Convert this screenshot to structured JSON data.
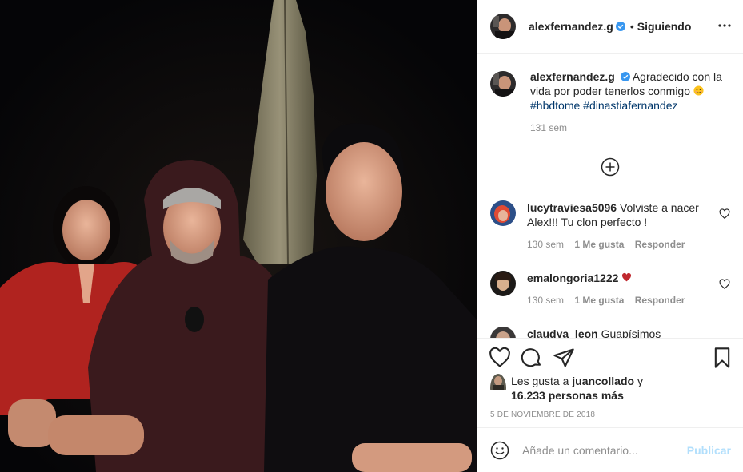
{
  "post": {
    "username": "alexfernandez.g",
    "verified": true,
    "separator": "•",
    "follow_state": "Siguiendo",
    "more_icon": "more-horizontal-icon"
  },
  "caption": {
    "username": "alexfernandez.g",
    "text": "Agradecido con la vida por poder tenerlos conmigo",
    "emoji": "smiling-face-emoji",
    "hashtags": [
      "#hbdtome",
      "#dinastiafernandez"
    ],
    "time": "131 sem"
  },
  "load_more_icon": "plus-circle-icon",
  "comments": [
    {
      "username": "lucytraviesa5096",
      "text": "Volviste a nacer Alex!!! Tu clon perfecto !",
      "time": "130 sem",
      "likes": "1 Me gusta",
      "reply": "Responder"
    },
    {
      "username": "emalongoria1222",
      "text": "",
      "emoji": "red-heart-emoji",
      "time": "130 sem",
      "likes": "1 Me gusta",
      "reply": "Responder"
    },
    {
      "username": "claudya_leon",
      "text": "Guapísimos"
    }
  ],
  "likes": {
    "prefix": "Les gusta a",
    "user": "juancollado",
    "conj": "y",
    "count": "16.233 personas más"
  },
  "date": "5 DE NOVIEMBRE DE 2018",
  "add_comment": {
    "placeholder": "Añade un comentario...",
    "publish": "Publicar"
  },
  "colors": {
    "link": "#00376b",
    "muted": "#8e8e8e",
    "verified": "#3897f0",
    "publish_disabled": "#b2dffc",
    "heart": "#ed4956"
  }
}
